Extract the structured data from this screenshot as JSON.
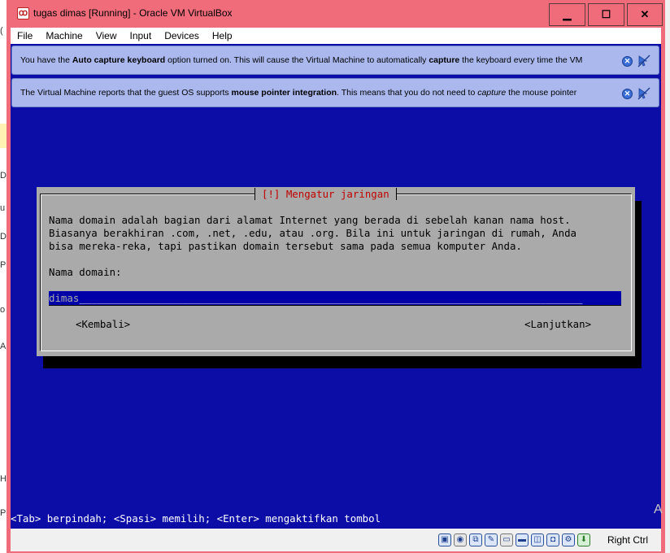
{
  "window": {
    "title": "tugas dimas [Running] - Oracle VM VirtualBox",
    "controls": {
      "minimize": "▁",
      "maximize": "☐",
      "close": "✕"
    }
  },
  "menu": {
    "items": [
      "File",
      "Machine",
      "View",
      "Input",
      "Devices",
      "Help"
    ]
  },
  "notices": {
    "keyboard": {
      "t1": "You have the ",
      "b1": "Auto capture keyboard",
      "t2": " option turned on. This will cause the Virtual Machine to automatically ",
      "b2": "capture",
      "t3": " the keyboard every time the VM"
    },
    "mouse": {
      "t1": "The Virtual Machine reports that the guest OS supports ",
      "b1": "mouse pointer integration",
      "t2": ". This means that you do not need to ",
      "i1": "capture",
      "t3": " the mouse pointer"
    }
  },
  "dialog": {
    "title": "[!] Mengatur jaringan",
    "body": [
      "Nama domain adalah bagian dari alamat Internet yang berada di sebelah kanan nama host.",
      "Biasanya berakhiran .com, .net, .edu, atau .org. Bila ini untuk jaringan di rumah, Anda",
      "bisa mereka-reka, tapi pastikan domain tersebut sama pada semua komputer Anda."
    ],
    "field_label": "Nama domain:",
    "field_value": "dimas",
    "field_fill": "___________________________________________________________________________________",
    "back_button": "<Kembali>",
    "continue_button": "<Lanjutkan>"
  },
  "help_line": "<Tab> berpindah; <Spasi> memilih; <Enter> mengaktifkan tombol",
  "statusbar": {
    "icons": [
      "hard-disk-icon",
      "optical-drive-icon",
      "network-icon",
      "usb-icon",
      "shared-folder-icon",
      "display-icon",
      "video-capture-icon",
      "guest-additions-icon",
      "cpu-icon",
      "mouse-integration-icon"
    ],
    "host_key": "Right Ctrl"
  },
  "background_app": {
    "peek_letters": [
      "(",
      "D",
      "u",
      "De",
      "Pr",
      "o",
      "Al",
      "H",
      "Pe"
    ],
    "watermark": "A"
  },
  "colors": {
    "titlebar": "#f06c7a",
    "vm_background": "#0c0ca6",
    "dialog_background": "#aaaaaa",
    "dialog_title": "#c00000",
    "notice_background": "#aab8ee"
  }
}
